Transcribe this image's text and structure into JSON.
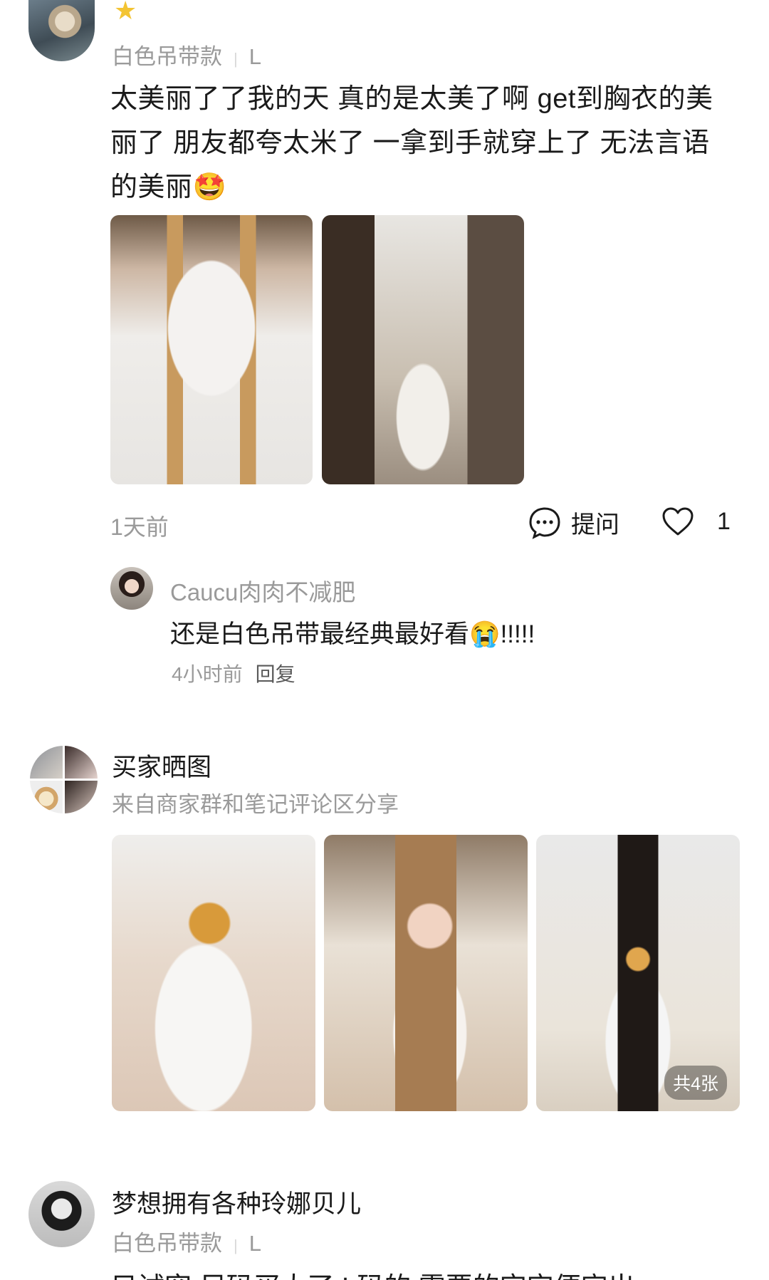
{
  "review1": {
    "variant": "白色吊带款",
    "size": "L",
    "text": "太美丽了了我的天 真的是太美了啊 get到胸衣的美丽了 朋友都夸太米了 一拿到手就穿上了 无法言语的美丽🤩",
    "time": "1天前",
    "ask_label": "提问",
    "like_count": "1",
    "reply": {
      "user": "Caucu肉肉不减肥",
      "text": "还是白色吊带最经典最好看😭!!!!!",
      "time": "4小时前",
      "reply_label": "回复"
    }
  },
  "buyer_show": {
    "title": "买家晒图",
    "subtitle": "来自商家群和笔记评论区分享",
    "count_badge": "共4张"
  },
  "review2": {
    "user": "梦想拥有各种玲娜贝儿",
    "variant": "白色吊带款",
    "size": "L",
    "text_cut": "只试穿 尺码买大了 L码的 需要的宝宝便宜出"
  },
  "icons": {
    "star": "star-icon",
    "ask": "chat-bubble-icon",
    "like": "heart-icon"
  },
  "colors": {
    "text_primary": "#1a1a1a",
    "text_secondary": "#9a9a9a",
    "star": "#f3c433"
  }
}
